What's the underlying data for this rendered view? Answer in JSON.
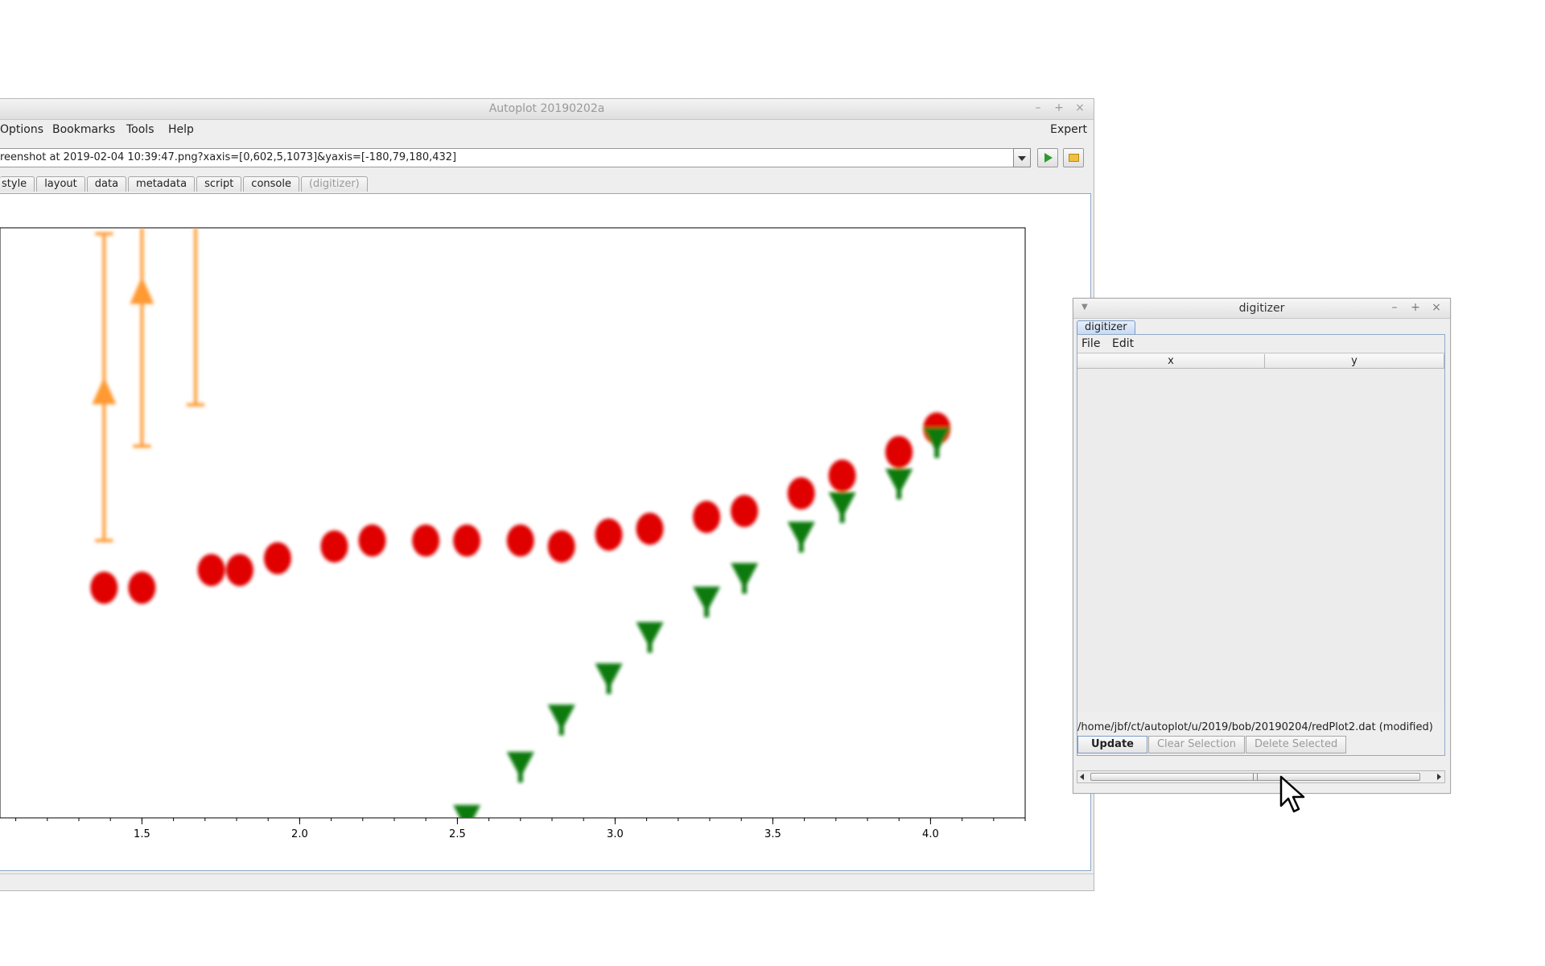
{
  "main_window": {
    "title": "Autoplot 20190202a",
    "menus": [
      "Options",
      "Bookmarks",
      "Tools",
      "Help"
    ],
    "expert_label": "Expert",
    "url": "reenshot at 2019-02-04 10:39:47.png?xaxis=[0,602,5,1073]&yaxis=[-180,79,180,432]",
    "tabs": [
      "style",
      "layout",
      "data",
      "metadata",
      "script",
      "console",
      "(digitizer)"
    ],
    "icons": {
      "dropdown": "chevron-down-icon",
      "go": "play-icon",
      "browse": "folder-icon"
    }
  },
  "digitizer": {
    "title": "digitizer",
    "tab_label": "digitizer",
    "menus": [
      "File",
      "Edit"
    ],
    "columns": [
      "x",
      "y"
    ],
    "rows": [],
    "file_path": "/home/jbf/ct/autoplot/u/2019/bob/20190204/redPlot2.dat (modified)",
    "buttons": {
      "update": "Update",
      "clear": "Clear Selection",
      "delete": "Delete Selected"
    }
  },
  "chart_data": {
    "type": "scatter",
    "title": "",
    "xlabel": "",
    "ylabel": "",
    "xlim": [
      1.05,
      4.3
    ],
    "ylim": [
      0,
      1
    ],
    "x_ticks": [
      1.5,
      2.0,
      2.5,
      3.0,
      3.5,
      4.0
    ],
    "x_tick_labels": [
      "1.5",
      "2.0",
      "2.5",
      "3.0",
      "3.5",
      "4.0"
    ],
    "grid": false,
    "colors": {
      "red": "#e00000",
      "green": "#0a7a10",
      "orange": "#ff9a30"
    },
    "series": [
      {
        "color": "#e00000",
        "marker": "circle",
        "x": [
          1.38,
          1.5,
          1.72,
          1.81,
          1.93,
          2.11,
          2.23,
          2.4,
          2.53,
          2.7,
          2.83,
          2.98,
          3.11,
          3.29,
          3.41,
          3.59,
          3.72,
          3.9,
          4.02
        ],
        "y": [
          0.39,
          0.39,
          0.42,
          0.42,
          0.44,
          0.46,
          0.47,
          0.47,
          0.47,
          0.47,
          0.46,
          0.48,
          0.49,
          0.51,
          0.52,
          0.55,
          0.58,
          0.62,
          0.66
        ]
      },
      {
        "color": "#0a7a10",
        "marker": "triangle-down",
        "x": [
          2.53,
          2.7,
          2.83,
          2.98,
          3.11,
          3.29,
          3.41,
          3.59,
          3.72,
          3.9,
          4.02
        ],
        "y": [
          0.0,
          0.09,
          0.17,
          0.24,
          0.31,
          0.37,
          0.41,
          0.48,
          0.53,
          0.57,
          0.64
        ]
      },
      {
        "color": "#ff9a30",
        "marker": "triangle-up-errorbar",
        "points": [
          {
            "x": 1.38,
            "y": 0.72,
            "low": 0.47,
            "high": 0.99
          },
          {
            "x": 1.5,
            "y": 0.89,
            "low": 0.63,
            "high": 1.0
          },
          {
            "x": 1.67,
            "y": null,
            "low": 0.7,
            "high": 1.0
          }
        ]
      }
    ]
  }
}
